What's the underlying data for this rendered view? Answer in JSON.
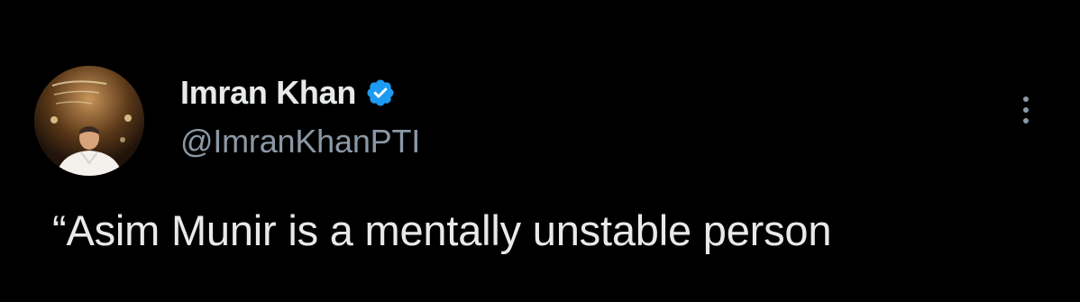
{
  "author": {
    "display_name": "Imran Khan",
    "handle": "@ImranKhanPTI",
    "verified": true,
    "verified_icon": "verified-badge-icon",
    "verified_color": "#1d9bf0"
  },
  "tweet": {
    "text": "“Asim Munir is a mentally unstable person"
  },
  "menu": {
    "icon": "more-vertical-icon"
  },
  "colors": {
    "background": "#000000",
    "primary_text": "#e7e9ea",
    "secondary_text": "#8b98a5"
  }
}
